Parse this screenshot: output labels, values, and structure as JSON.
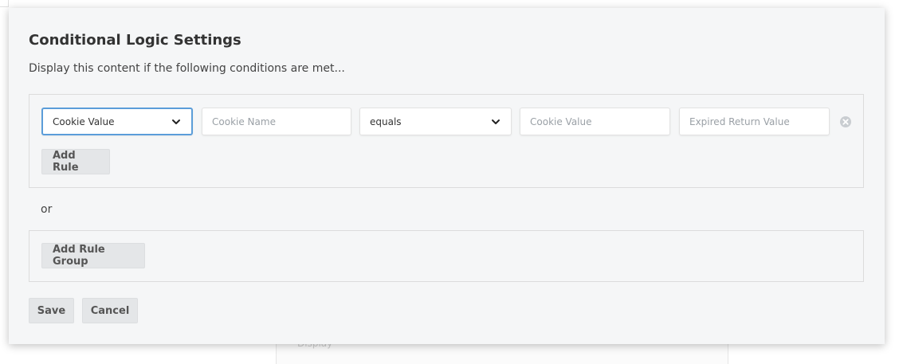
{
  "background": {
    "fragment_text": "Display"
  },
  "modal": {
    "title": "Conditional Logic Settings",
    "subtitle": "Display this content if the following conditions are met...",
    "rule_group": {
      "rule": {
        "type_select": {
          "value": "Cookie Value",
          "icon": "chevron-down-icon"
        },
        "cookie_name": {
          "value": "",
          "placeholder": "Cookie Name"
        },
        "operator_select": {
          "value": "equals",
          "icon": "chevron-down-icon"
        },
        "cookie_value": {
          "value": "",
          "placeholder": "Cookie Value"
        },
        "expired_return": {
          "value": "",
          "placeholder": "Expired Return Value"
        },
        "remove_icon": "close-circle-icon"
      },
      "add_rule_label": "Add Rule"
    },
    "or_label": "or",
    "add_rule_group_label": "Add Rule Group",
    "footer": {
      "save_label": "Save",
      "cancel_label": "Cancel"
    }
  },
  "colors": {
    "focus_border": "#5b9dd9",
    "modal_bg": "#f5f6f7",
    "button_bg": "#e4e6e8"
  }
}
